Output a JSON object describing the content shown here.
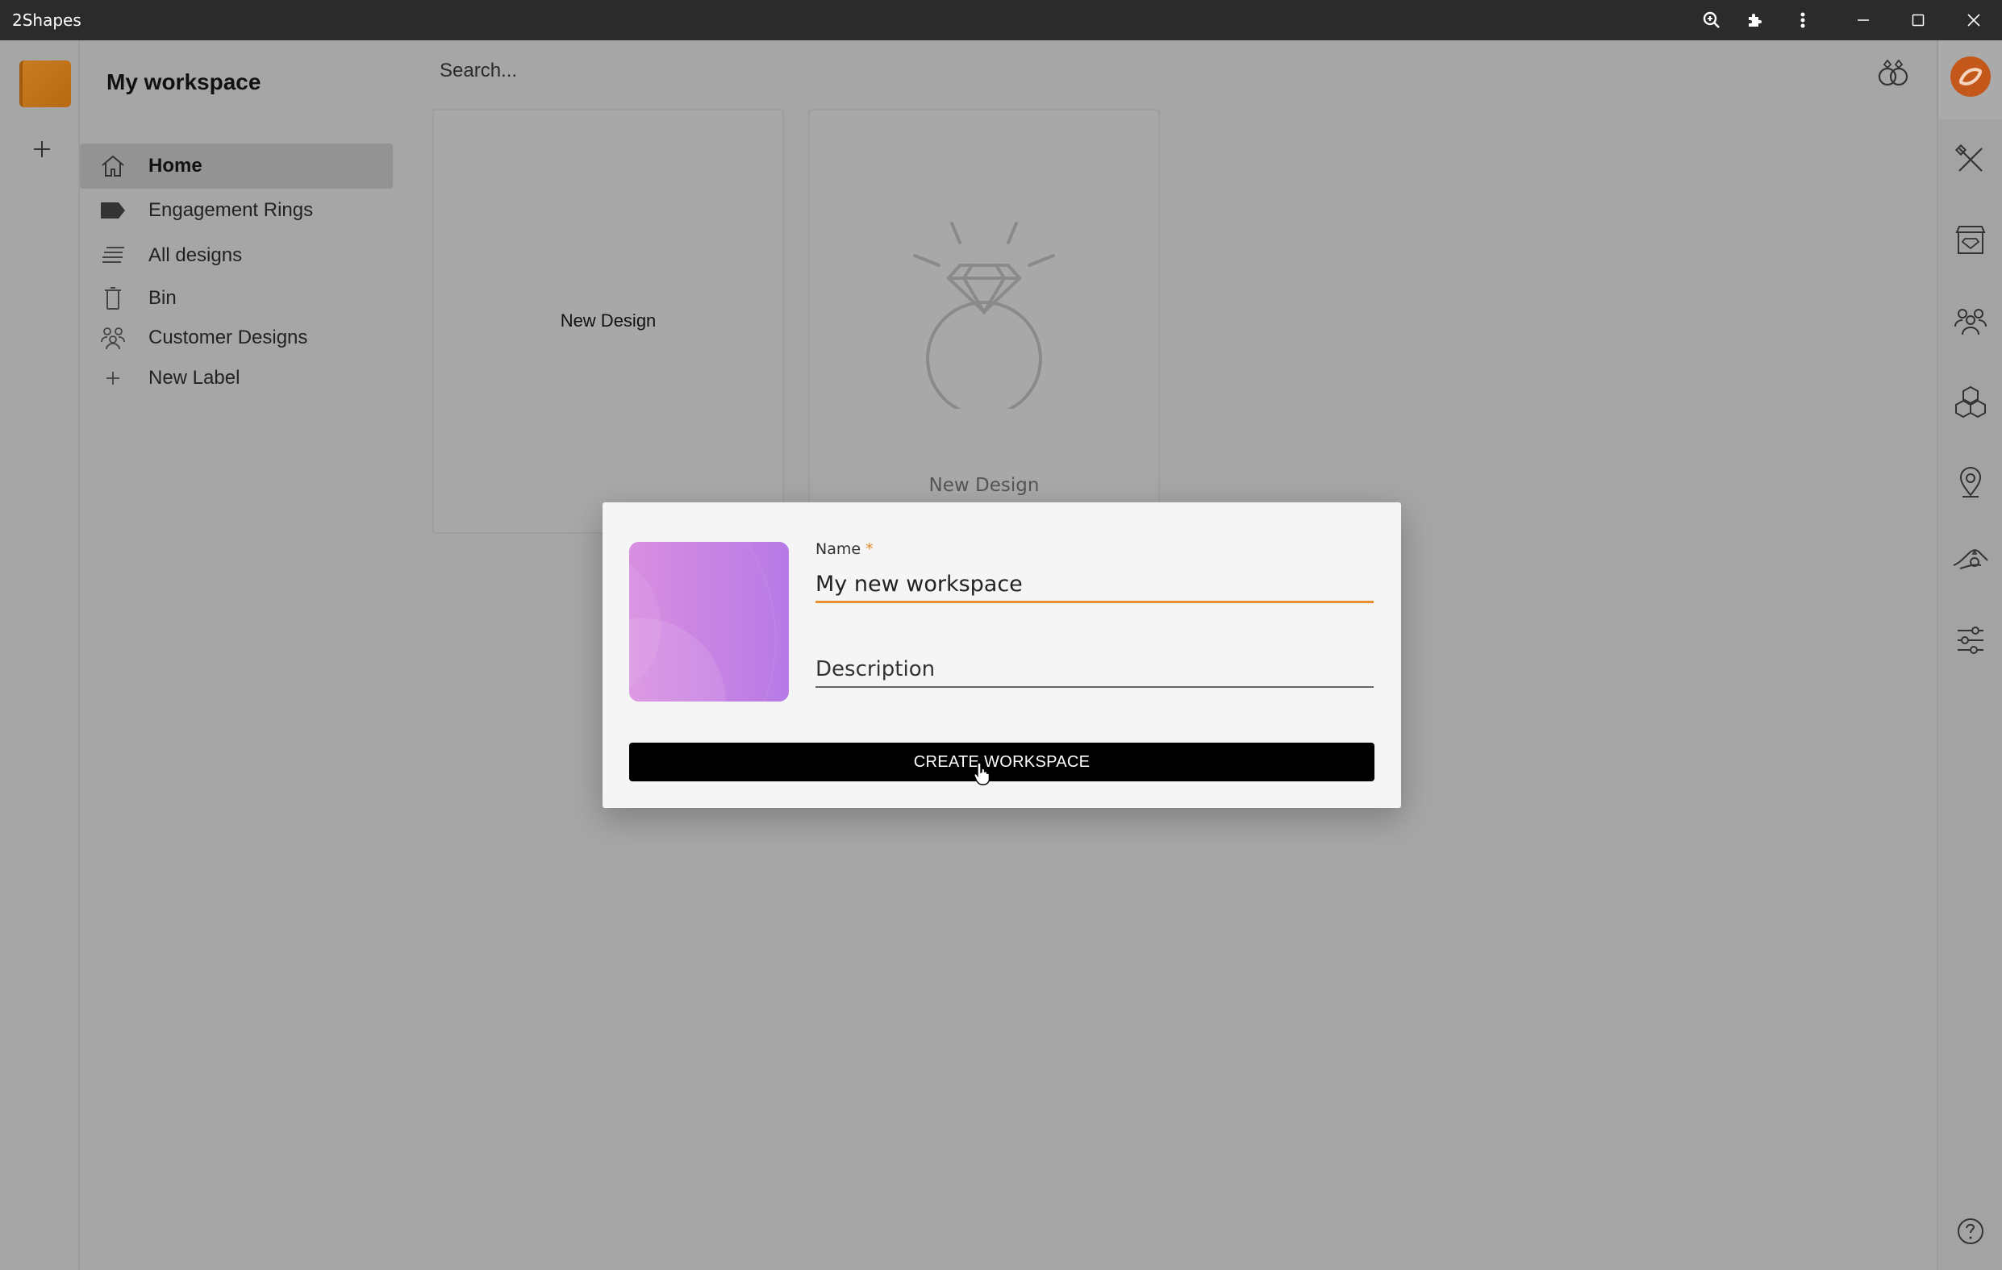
{
  "window": {
    "title": "2Shapes",
    "icons": [
      "zoom-icon",
      "extensions-icon",
      "more-vert-icon",
      "minimize-icon",
      "maximize-icon",
      "close-icon"
    ]
  },
  "workspace_rail": {
    "add_icon": "plus-icon",
    "thumb_color": "#c97b20"
  },
  "sidebar": {
    "workspace_name": "My workspace",
    "items": [
      {
        "label": "Home",
        "icon": "home-icon",
        "active": true
      },
      {
        "label": "Engagement Rings",
        "icon": "label-icon",
        "active": false
      },
      {
        "label": "All designs",
        "icon": "stack-icon",
        "active": false
      },
      {
        "label": "Bin",
        "icon": "bin-icon",
        "active": false
      },
      {
        "label": "Customer Designs",
        "icon": "group-icon",
        "active": false
      },
      {
        "label": "New Label",
        "icon": "plus-icon",
        "active": false
      }
    ]
  },
  "main": {
    "search_placeholder": "Search...",
    "cards": [
      {
        "label": "New Design"
      },
      {
        "label": "New Design",
        "icon": "ring-icon"
      }
    ]
  },
  "right_rail": {
    "icons": [
      "brand-logo-icon",
      "tools-icon",
      "store-icon",
      "users-icon",
      "boxes-icon",
      "location-ring-icon",
      "hand-ring-icon",
      "sliders-icon",
      "help-icon"
    ]
  },
  "dialog": {
    "name_label": "Name",
    "required_mark": "*",
    "name_value": "My new workspace",
    "description_placeholder": "Description",
    "create_button": "CREATE WORKSPACE",
    "avatar_colors": [
      "#d98ee0",
      "#b77ae6"
    ],
    "accent": "#e88f2e"
  }
}
